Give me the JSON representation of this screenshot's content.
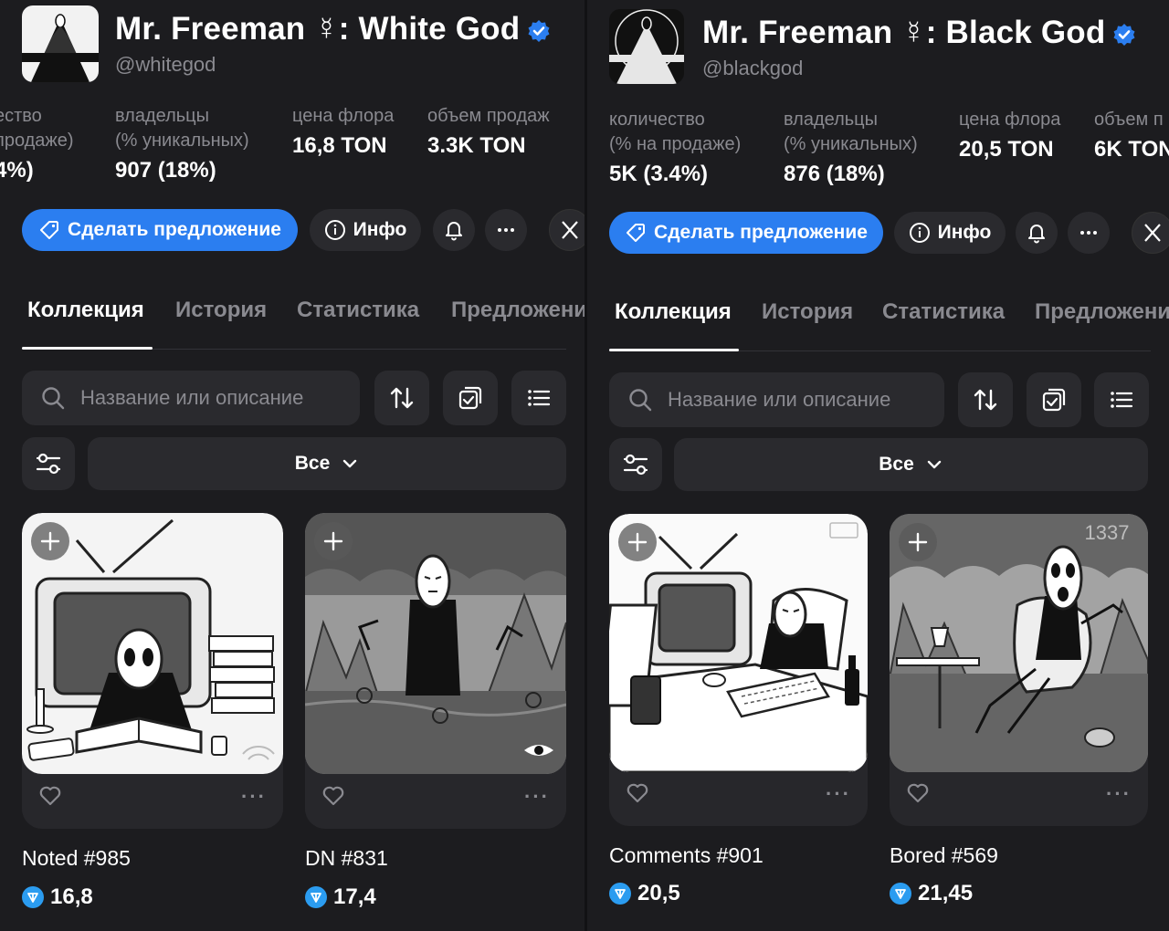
{
  "panels": [
    {
      "title": "Mr. Freeman ☿: White God",
      "handle": "@whitegod",
      "stats": [
        {
          "label1": "ество",
          "label2": "продаже)",
          "value": "4%)"
        },
        {
          "label1": "владельцы",
          "label2": "(% уникальных)",
          "value": "907 (18%)"
        },
        {
          "label1": "цена флора",
          "label2": "",
          "value": "16,8 TON"
        },
        {
          "label1": "объем продаж",
          "label2": "",
          "value": "3.3K TON"
        }
      ],
      "actions": {
        "offer": "Сделать предложение",
        "info": "Инфо"
      },
      "tabs": [
        "Коллекция",
        "История",
        "Статистика",
        "Предложени"
      ],
      "search": {
        "placeholder": "Название или описание"
      },
      "filter": {
        "selected": "Все"
      },
      "items": [
        {
          "name": "Noted #985",
          "price": "16,8"
        },
        {
          "name": "DN #831",
          "price": "17,4"
        }
      ]
    },
    {
      "title": "Mr. Freeman ☿: Black God",
      "handle": "@blackgod",
      "stats": [
        {
          "label1": "количество",
          "label2": "(% на продаже)",
          "value": "5K (3.4%)"
        },
        {
          "label1": "владельцы",
          "label2": "(% уникальных)",
          "value": "876 (18%)"
        },
        {
          "label1": "цена флора",
          "label2": "",
          "value": "20,5 TON"
        },
        {
          "label1": "объем п",
          "label2": "",
          "value": "6K TON"
        }
      ],
      "actions": {
        "offer": "Сделать предложение",
        "info": "Инфо"
      },
      "tabs": [
        "Коллекция",
        "История",
        "Статистика",
        "Предложени"
      ],
      "search": {
        "placeholder": "Название или описание"
      },
      "filter": {
        "selected": "Все"
      },
      "items": [
        {
          "name": "Comments #901",
          "price": "20,5",
          "badge": "",
          "corner": ""
        },
        {
          "name": "Bored #569",
          "price": "21,45",
          "corner": "1337"
        }
      ]
    }
  ],
  "colors": {
    "accent": "#2b7ef0",
    "background": "#1c1c1f",
    "surface": "#2a2a2e",
    "muted": "#8a8a90",
    "ton": "#2b9cf0"
  }
}
